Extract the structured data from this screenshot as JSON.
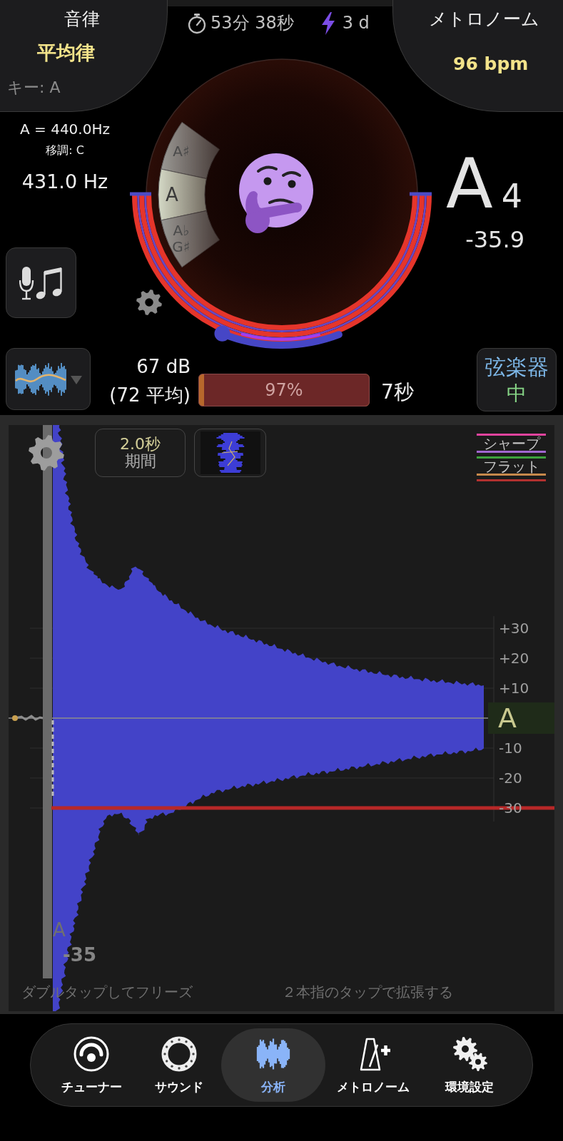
{
  "header": {
    "temperament": {
      "label": "音律",
      "value": "平均律",
      "key": "キー: A"
    },
    "session_time": "53分 38秒",
    "streak": "3 d",
    "metronome": {
      "label": "メトロノーム",
      "tempo": "96 bpm"
    }
  },
  "reference": {
    "pitch": "A = 440.0Hz",
    "transpose": "移調: C",
    "frequency": "431.0 Hz"
  },
  "note_wheel": [
    {
      "names": [
        "A♯"
      ],
      "selected": false
    },
    {
      "names": [
        "A"
      ],
      "selected": true
    },
    {
      "names": [
        "A♭",
        "G♯"
      ],
      "selected": false
    }
  ],
  "dial_slider": {
    "level": 0
  },
  "detected_note": {
    "name": "A",
    "octave": "4",
    "cents": "-35.9"
  },
  "level_meter": {
    "volume": "67 dB",
    "average": "(72 平均)",
    "confidence": "97%",
    "level": 0.97,
    "duration": "7秒"
  },
  "instrument": {
    "name": "弦楽器",
    "sensitivity": "中"
  },
  "analysis": {
    "duration": {
      "value": "2.0秒",
      "label": "期間"
    },
    "legend": [
      {
        "kind": "line",
        "color": "#e0449e"
      },
      {
        "kind": "label",
        "label": "シャープ",
        "color": "#a166d0"
      },
      {
        "kind": "line",
        "color": "#3da23d"
      },
      {
        "kind": "label",
        "label": "フラット",
        "color": "#c6894b"
      },
      {
        "kind": "line",
        "color": "#b3312f"
      }
    ],
    "scale": [
      {
        "kind": "tick",
        "label": "+30"
      },
      {
        "kind": "tick",
        "label": "+20"
      },
      {
        "kind": "tick",
        "label": "+10"
      },
      {
        "kind": "note",
        "label": "A"
      },
      {
        "kind": "tick",
        "label": "-10"
      },
      {
        "kind": "tick",
        "label": "-20"
      },
      {
        "kind": "tick",
        "label": "-30"
      }
    ],
    "marker": {
      "note": "A",
      "cents": "-35"
    },
    "hints": [
      "ダブルタップしてフリーズ",
      "２本指のタップで拡張する"
    ]
  },
  "nav": [
    {
      "label": "チューナー",
      "kind": "tuner",
      "selected": false
    },
    {
      "label": "サウンド",
      "kind": "sound",
      "selected": false
    },
    {
      "label": "分析",
      "kind": "analysis",
      "selected": true
    },
    {
      "label": "メトロノーム",
      "kind": "metronome",
      "selected": false
    },
    {
      "label": "環境設定",
      "kind": "settings",
      "selected": false
    }
  ]
}
